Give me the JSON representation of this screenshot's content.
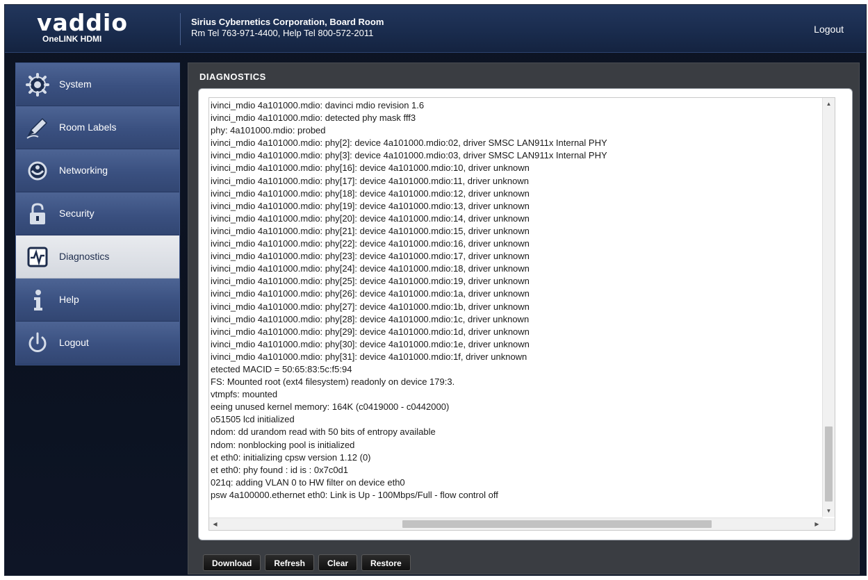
{
  "header": {
    "logo_text": "vaddio",
    "product_name": "OneLINK HDMI",
    "room_name": "Sirius Cybernetics Corporation, Board Room",
    "room_phones": "Rm Tel 763-971-4400, Help Tel 800-572-2011",
    "logout_label": "Logout"
  },
  "sidebar": {
    "items": [
      {
        "label": "System",
        "icon": "gear-icon",
        "active": false
      },
      {
        "label": "Room Labels",
        "icon": "pencil-icon",
        "active": false
      },
      {
        "label": "Networking",
        "icon": "network-icon",
        "active": false
      },
      {
        "label": "Security",
        "icon": "lock-icon",
        "active": false
      },
      {
        "label": "Diagnostics",
        "icon": "diagnostics-icon",
        "active": true
      },
      {
        "label": "Help",
        "icon": "info-icon",
        "active": false
      },
      {
        "label": "Logout",
        "icon": "power-icon",
        "active": false
      }
    ]
  },
  "main": {
    "title": "DIAGNOSTICS",
    "log_lines": [
      "ivinci_mdio 4a101000.mdio: davinci mdio revision 1.6",
      "ivinci_mdio 4a101000.mdio: detected phy mask fff3",
      "phy: 4a101000.mdio: probed",
      "ivinci_mdio 4a101000.mdio: phy[2]: device 4a101000.mdio:02, driver SMSC LAN911x Internal PHY",
      "ivinci_mdio 4a101000.mdio: phy[3]: device 4a101000.mdio:03, driver SMSC LAN911x Internal PHY",
      "ivinci_mdio 4a101000.mdio: phy[16]: device 4a101000.mdio:10, driver unknown",
      "ivinci_mdio 4a101000.mdio: phy[17]: device 4a101000.mdio:11, driver unknown",
      "ivinci_mdio 4a101000.mdio: phy[18]: device 4a101000.mdio:12, driver unknown",
      "ivinci_mdio 4a101000.mdio: phy[19]: device 4a101000.mdio:13, driver unknown",
      "ivinci_mdio 4a101000.mdio: phy[20]: device 4a101000.mdio:14, driver unknown",
      "ivinci_mdio 4a101000.mdio: phy[21]: device 4a101000.mdio:15, driver unknown",
      "ivinci_mdio 4a101000.mdio: phy[22]: device 4a101000.mdio:16, driver unknown",
      "ivinci_mdio 4a101000.mdio: phy[23]: device 4a101000.mdio:17, driver unknown",
      "ivinci_mdio 4a101000.mdio: phy[24]: device 4a101000.mdio:18, driver unknown",
      "ivinci_mdio 4a101000.mdio: phy[25]: device 4a101000.mdio:19, driver unknown",
      "ivinci_mdio 4a101000.mdio: phy[26]: device 4a101000.mdio:1a, driver unknown",
      "ivinci_mdio 4a101000.mdio: phy[27]: device 4a101000.mdio:1b, driver unknown",
      "ivinci_mdio 4a101000.mdio: phy[28]: device 4a101000.mdio:1c, driver unknown",
      "ivinci_mdio 4a101000.mdio: phy[29]: device 4a101000.mdio:1d, driver unknown",
      "ivinci_mdio 4a101000.mdio: phy[30]: device 4a101000.mdio:1e, driver unknown",
      "ivinci_mdio 4a101000.mdio: phy[31]: device 4a101000.mdio:1f, driver unknown",
      "etected MACID = 50:65:83:5c:f5:94",
      "FS: Mounted root (ext4 filesystem) readonly on device 179:3.",
      "vtmpfs: mounted",
      "eeing unused kernel memory: 164K (c0419000 - c0442000)",
      "o51505 lcd initialized",
      "ndom: dd urandom read with 50 bits of entropy available",
      "ndom: nonblocking pool is initialized",
      "et eth0: initializing cpsw version 1.12 (0)",
      "et eth0: phy found : id is : 0x7c0d1",
      "021q: adding VLAN 0 to HW filter on device eth0",
      "psw 4a100000.ethernet eth0: Link is Up - 100Mbps/Full - flow control off"
    ],
    "buttons": {
      "download": "Download",
      "refresh": "Refresh",
      "clear": "Clear",
      "restore": "Restore"
    }
  },
  "colors": {
    "header_bg": "#1a2c4e",
    "nav_bg": "#3a5080",
    "nav_active_bg": "#d4d8df",
    "panel_bg": "#3a3d42",
    "button_bg": "#111111"
  }
}
